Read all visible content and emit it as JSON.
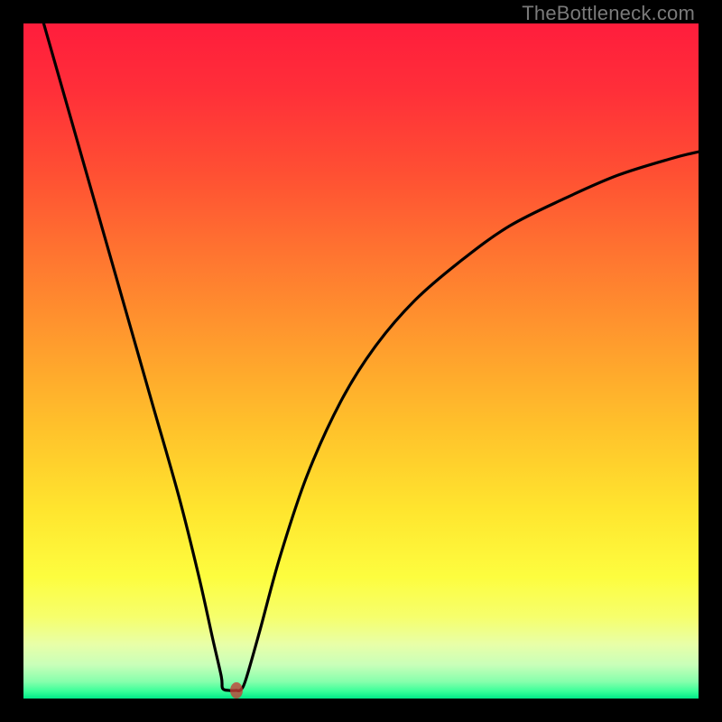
{
  "watermark": {
    "text": "TheBottleneck.com"
  },
  "colors": {
    "gradient_stops": [
      {
        "offset": 0.0,
        "color": "#ff1d3c"
      },
      {
        "offset": 0.1,
        "color": "#ff2f39"
      },
      {
        "offset": 0.22,
        "color": "#ff4f33"
      },
      {
        "offset": 0.35,
        "color": "#ff7730"
      },
      {
        "offset": 0.48,
        "color": "#ff9e2d"
      },
      {
        "offset": 0.6,
        "color": "#ffc22b"
      },
      {
        "offset": 0.72,
        "color": "#ffe52e"
      },
      {
        "offset": 0.82,
        "color": "#fdfd3f"
      },
      {
        "offset": 0.88,
        "color": "#f6ff6d"
      },
      {
        "offset": 0.92,
        "color": "#e8ffa8"
      },
      {
        "offset": 0.95,
        "color": "#c9ffb9"
      },
      {
        "offset": 0.975,
        "color": "#86ffac"
      },
      {
        "offset": 0.99,
        "color": "#35ff98"
      },
      {
        "offset": 1.0,
        "color": "#00e888"
      }
    ],
    "curve": "#000000",
    "marker": "rgba(198,60,54,0.78)",
    "frame": "#000000"
  },
  "chart_data": {
    "type": "line",
    "title": "",
    "xlabel": "",
    "ylabel": "",
    "xlim": [
      0,
      100
    ],
    "ylim": [
      0,
      100
    ],
    "marker": {
      "x": 31.5,
      "y": 1.2
    },
    "series": [
      {
        "name": "bottleneck-curve",
        "points": [
          {
            "x": 3.0,
            "y": 100.0
          },
          {
            "x": 7.0,
            "y": 86.0
          },
          {
            "x": 11.0,
            "y": 72.0
          },
          {
            "x": 15.0,
            "y": 58.0
          },
          {
            "x": 19.0,
            "y": 44.0
          },
          {
            "x": 23.0,
            "y": 30.0
          },
          {
            "x": 26.0,
            "y": 18.0
          },
          {
            "x": 28.0,
            "y": 9.0
          },
          {
            "x": 29.3,
            "y": 3.3
          },
          {
            "x": 29.5,
            "y": 1.5
          },
          {
            "x": 30.5,
            "y": 1.2
          },
          {
            "x": 31.5,
            "y": 1.2
          },
          {
            "x": 32.2,
            "y": 1.3
          },
          {
            "x": 33.0,
            "y": 3.0
          },
          {
            "x": 35.0,
            "y": 10.0
          },
          {
            "x": 38.0,
            "y": 21.0
          },
          {
            "x": 42.0,
            "y": 33.0
          },
          {
            "x": 47.0,
            "y": 44.0
          },
          {
            "x": 52.0,
            "y": 52.0
          },
          {
            "x": 58.0,
            "y": 59.0
          },
          {
            "x": 65.0,
            "y": 65.0
          },
          {
            "x": 72.0,
            "y": 70.0
          },
          {
            "x": 80.0,
            "y": 74.0
          },
          {
            "x": 88.0,
            "y": 77.5
          },
          {
            "x": 96.0,
            "y": 80.0
          },
          {
            "x": 100.0,
            "y": 81.0
          }
        ]
      }
    ]
  }
}
